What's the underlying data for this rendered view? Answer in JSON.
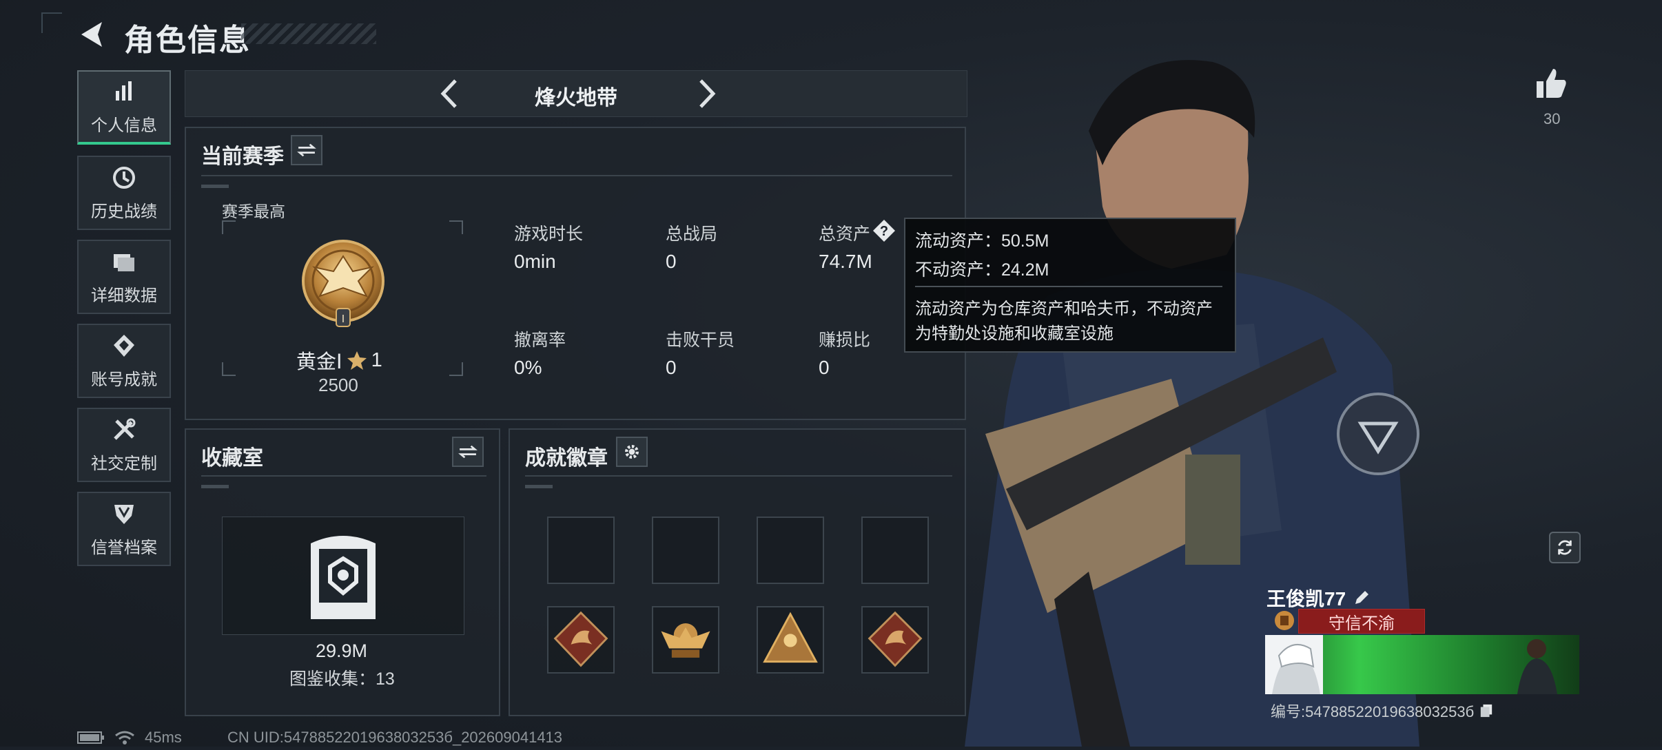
{
  "header": {
    "title": "角色信息"
  },
  "sidebar": {
    "items": [
      {
        "label": "个人信息",
        "icon": "bar-chart-icon",
        "active": true
      },
      {
        "label": "历史战绩",
        "icon": "history-icon"
      },
      {
        "label": "详细数据",
        "icon": "folder-icon"
      },
      {
        "label": "账号成就",
        "icon": "achievement-icon"
      },
      {
        "label": "社交定制",
        "icon": "tools-icon"
      },
      {
        "label": "信誉档案",
        "icon": "shield-icon"
      }
    ]
  },
  "mode": {
    "name": "烽火地带"
  },
  "season": {
    "title": "当前赛季",
    "best_label": "赛季最高",
    "rank_name": "黄金Ⅰ",
    "rank_stars": "1",
    "rank_score": "2500",
    "stats": [
      {
        "label": "游戏时长",
        "value": "0min"
      },
      {
        "label": "总战局",
        "value": "0"
      },
      {
        "label": "总资产",
        "value": "74.7M"
      },
      {
        "label": "撤离率",
        "value": "0%"
      },
      {
        "label": "击败干员",
        "value": "0"
      },
      {
        "label": "赚损比",
        "value": "0"
      }
    ]
  },
  "tooltip": {
    "liquid": "流动资产：50.5M",
    "fixed": "不动资产：24.2M",
    "desc_line1": "流动资产为仓库资产和哈夫币，不动资产",
    "desc_line2": "为特勤处设施和收藏室设施"
  },
  "collection": {
    "title": "收藏室",
    "value": "29.9M",
    "catalog": "图鉴收集：13"
  },
  "achievements": {
    "title": "成就徽章",
    "badges": [
      "empty",
      "empty",
      "empty",
      "empty",
      "dragon-badge",
      "eagle-badge",
      "pyramid-badge",
      "dragon-badge"
    ]
  },
  "profile": {
    "likes": "30",
    "name": "王俊凯77",
    "honor": "守信不渝",
    "uid": "编号:5478852201963803253б"
  },
  "status": {
    "ping": "45ms",
    "cn_uid": "CN UID:5478852201963803253б_202609041413"
  },
  "colors": {
    "accent": "#34c98e",
    "honor": "#8a1c1c"
  }
}
